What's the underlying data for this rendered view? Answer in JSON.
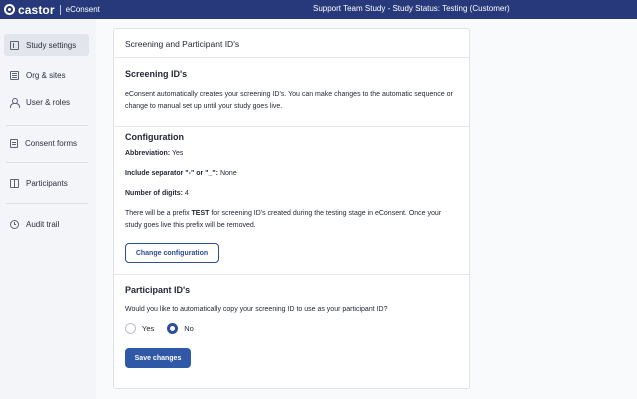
{
  "topbar": {
    "brand_name": "castor",
    "product": "eConsent",
    "title": "Support Team Study  - Study Status: Testing (Customer)"
  },
  "sidebar": {
    "items": [
      {
        "label": "Study settings",
        "icon": "settings-icon",
        "active": true
      },
      {
        "label": "Org & sites",
        "icon": "org-icon"
      },
      {
        "label": "User & roles",
        "icon": "user-icon"
      },
      {
        "label": "Consent forms",
        "icon": "document-icon"
      },
      {
        "label": "Participants",
        "icon": "participants-icon"
      },
      {
        "label": "Audit trail",
        "icon": "clock-icon"
      }
    ]
  },
  "card": {
    "header": "Screening and Participant ID's",
    "screening": {
      "title": "Screening ID's",
      "description": "eConsent automatically creates your screening ID's. You can make changes to the automatic sequence or change to manual set up until your study goes live."
    },
    "configuration": {
      "title": "Configuration",
      "abbreviation_label": "Abbreviation:",
      "abbreviation_value": "Yes",
      "separator_label": "Include separator \"-\" or \"_\":",
      "separator_value": "None",
      "digits_label": "Number of digits:",
      "digits_value": "4",
      "prefix_before": "There will be a prefix ",
      "prefix_value": "TEST",
      "prefix_after": " for screening ID's created during the testing stage in eConsent. Once your study goes live this prefix will be removed.",
      "change_button": "Change configuration"
    },
    "participant": {
      "title": "Participant ID's",
      "question": "Would you like to automatically copy your screening ID to use as your participant ID?",
      "option_yes": "Yes",
      "option_no": "No",
      "selected": "No",
      "save_button": "Save changes"
    }
  },
  "colors": {
    "topbar": "#27397a",
    "primary": "#2f58a6",
    "outline": "#2d4c9a"
  }
}
